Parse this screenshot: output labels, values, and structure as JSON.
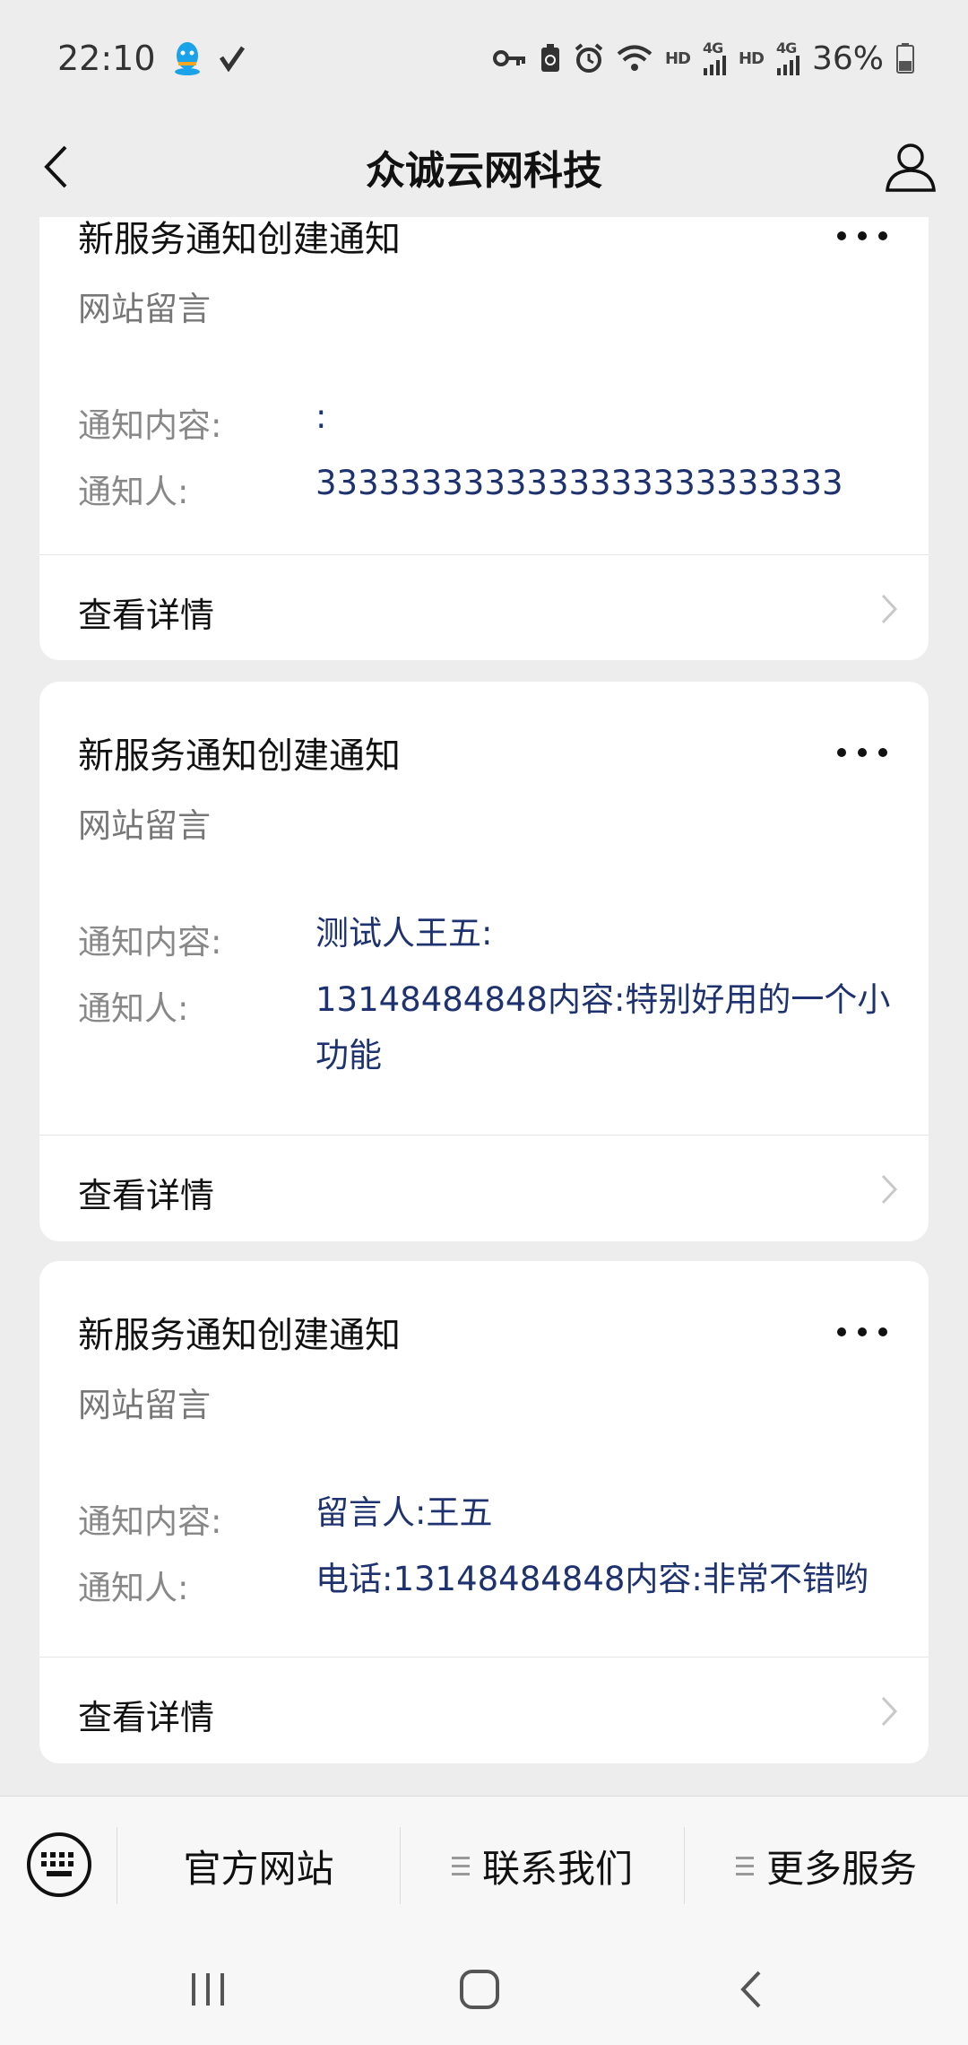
{
  "status_bar": {
    "time": "22:10",
    "network_hd_1": "HD",
    "network_4g_1": "4G",
    "network_hd_2": "HD",
    "network_4g_2": "4G",
    "battery": "36%",
    "icons": [
      "qq-icon",
      "check-icon",
      "key-icon",
      "battery-saver-icon",
      "alarm-icon",
      "wifi-icon",
      "signal-icon",
      "battery-icon"
    ]
  },
  "header": {
    "title": "众诚云网科技"
  },
  "cards": [
    {
      "title": "新服务通知创建通知",
      "subtitle": "网站留言",
      "content_label": "通知内容:",
      "content_value": ":",
      "notifier_label": "通知人:",
      "notifier_value": "3333333333333333333333333",
      "detail_label": "查看详情"
    },
    {
      "title": "新服务通知创建通知",
      "subtitle": "网站留言",
      "content_label": "通知内容:",
      "content_value": "测试人王五:",
      "notifier_label": "通知人:",
      "notifier_value": "13148484848内容:特别好用的一个小功能",
      "detail_label": "查看详情"
    },
    {
      "title": "新服务通知创建通知",
      "subtitle": "网站留言",
      "content_label": "通知内容:",
      "content_value": "留言人:王五",
      "notifier_label": "通知人:",
      "notifier_value": "电话:13148484848内容:非常不错哟",
      "detail_label": "查看详情"
    }
  ],
  "bottom_menu": {
    "items": [
      {
        "label": "官方网站"
      },
      {
        "label": "联系我们"
      },
      {
        "label": "更多服务"
      }
    ]
  },
  "colors": {
    "accent_value": "#1e3270",
    "background": "#ededed",
    "card": "#ffffff"
  }
}
